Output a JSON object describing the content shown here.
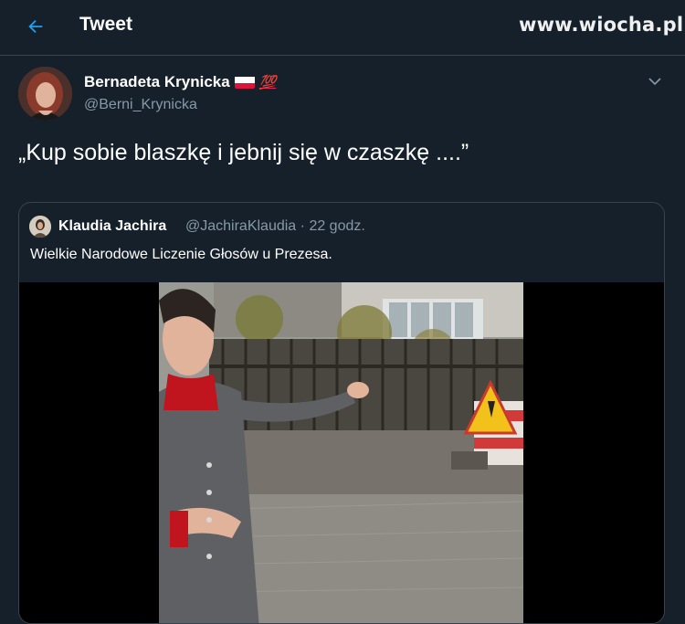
{
  "header": {
    "title": "Tweet",
    "watermark": "www.wiocha.pl"
  },
  "tweet": {
    "author_name": "Bernadeta Krynicka",
    "author_badge": "💯",
    "author_handle": "@Berni_Krynicka",
    "text": "„Kup sobie blaszkę i jebnij się w czaszkę ....”"
  },
  "quote": {
    "author_name": "Klaudia Jachira",
    "author_handle": "@JachiraKlaudia",
    "separator": "·",
    "time": "22 godz.",
    "text": "Wielkie Narodowe Liczenie Głosów u Prezesa."
  },
  "colors": {
    "background": "#15202b",
    "accent": "#1da1f2",
    "muted": "#8899a6",
    "border": "#38444d"
  },
  "icons": {
    "back": "back-arrow-icon",
    "more": "chevron-down-icon"
  }
}
